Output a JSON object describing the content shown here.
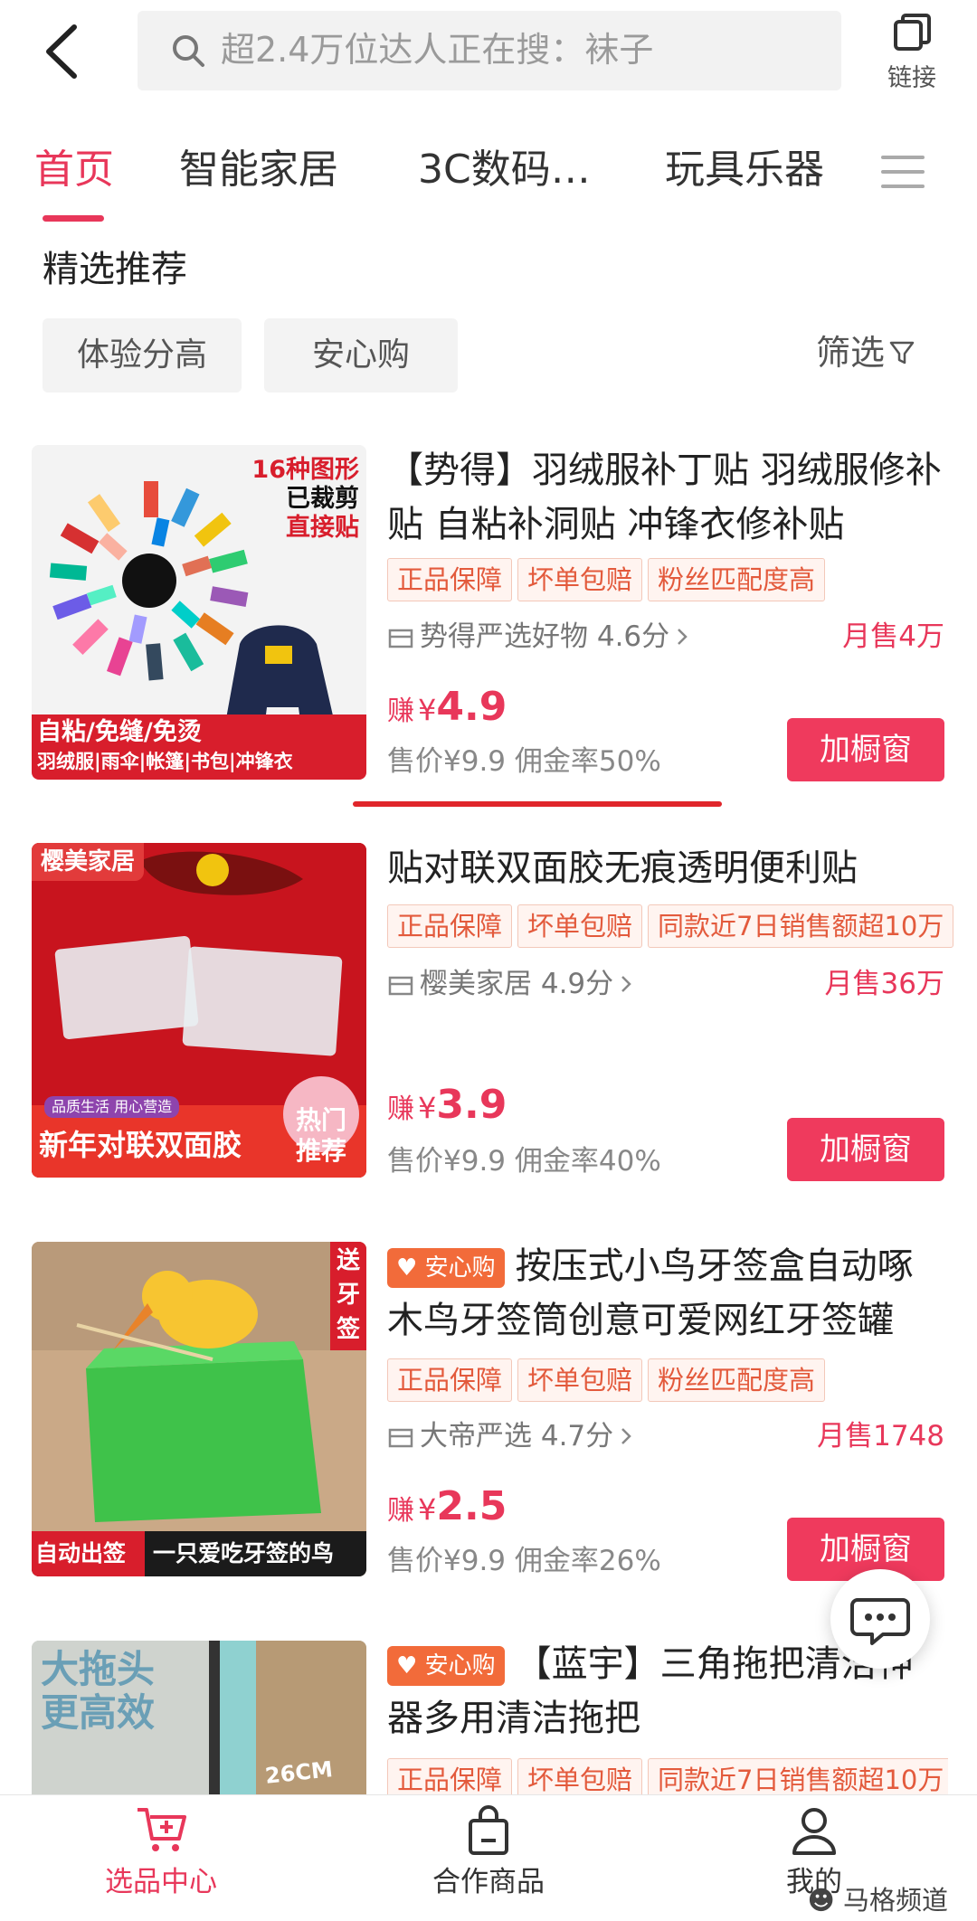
{
  "header": {
    "search_placeholder": "超2.4万位达人正在搜：袜子",
    "link_label": "链接"
  },
  "tabs": [
    {
      "label": "首页"
    },
    {
      "label": "智能家居"
    },
    {
      "label": "3C数码…"
    },
    {
      "label": "玩具乐器"
    }
  ],
  "section": {
    "title": "精选推荐",
    "chips": [
      "体验分高",
      "安心购"
    ],
    "filter_label": "筛选"
  },
  "products": [
    {
      "title": "【势得】羽绒服补丁贴 羽绒服修补贴 自粘补洞贴 冲锋衣修补贴",
      "badge": "",
      "tags": [
        "正品保障",
        "坏单包赔",
        "粉丝匹配度高"
      ],
      "shop": "势得严选好物 4.6分",
      "sales": "月售4万",
      "earn_label": "赚",
      "earn_currency": "¥",
      "earn_value": "4.9",
      "price": "售价¥9.9  佣金率50%",
      "button": "加橱窗",
      "image_text": [
        "16种图形",
        "已裁剪",
        "直接贴",
        "自粘/免缝/免烫",
        "羽绒服|雨伞|帐篷|书包|冲锋衣"
      ]
    },
    {
      "title": "贴对联双面胶无痕透明便利贴",
      "badge": "",
      "tags": [
        "正品保障",
        "坏单包赔",
        "同款近7日销售额超10万"
      ],
      "shop": "樱美家居 4.9分",
      "sales": "月售36万",
      "earn_label": "赚",
      "earn_currency": "¥",
      "earn_value": "3.9",
      "price": "售价¥9.9  佣金率40%",
      "button": "加橱窗",
      "image_text": [
        "樱美家居",
        "品质生活 用心营造",
        "新年对联双面胶",
        "热门",
        "推荐"
      ]
    },
    {
      "title": "按压式小鸟牙签盒自动啄木鸟牙签筒创意可爱网红牙签罐",
      "badge": "安心购",
      "tags": [
        "正品保障",
        "坏单包赔",
        "粉丝匹配度高"
      ],
      "shop": "大帝严选 4.7分",
      "sales": "月售1748",
      "earn_label": "赚",
      "earn_currency": "¥",
      "earn_value": "2.5",
      "price": "售价¥9.9  佣金率26%",
      "button": "加橱窗",
      "image_text": [
        "送",
        "牙",
        "签",
        "自动出签",
        "一只爱吃牙签的鸟"
      ]
    },
    {
      "title": "【蓝宇】三角拖把清洁神器多用清洁拖把",
      "badge": "安心购",
      "tags": [
        "正品保障",
        "坏单包赔",
        "同款近7日销售额超10万"
      ],
      "image_text": [
        "大拖头",
        "更高效",
        "26CM"
      ]
    }
  ],
  "bottom_nav": [
    {
      "label": "选品中心",
      "icon": "cart-plus-icon"
    },
    {
      "label": "合作商品",
      "icon": "bag-icon"
    },
    {
      "label": "我的",
      "icon": "user-icon"
    }
  ],
  "watermark": "马格频道",
  "colors": {
    "accent": "#e8375a",
    "button": "#ef3a5d",
    "badge": "#f26b3a",
    "tag_text": "#e35a3c"
  }
}
